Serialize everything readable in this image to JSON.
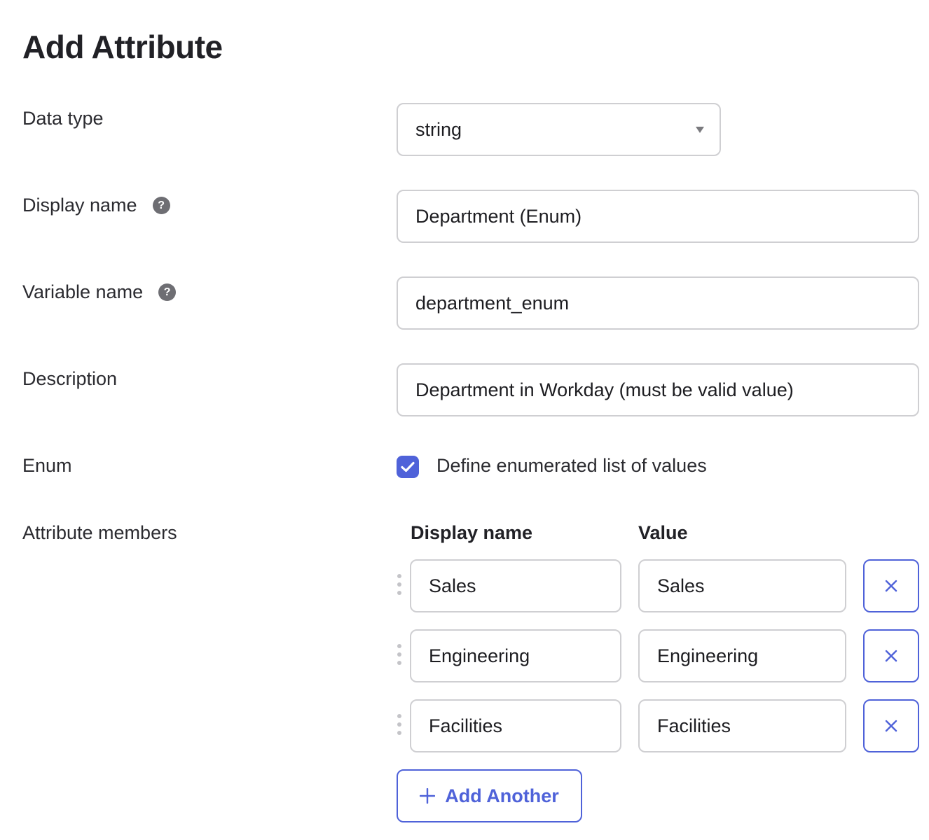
{
  "page": {
    "title": "Add Attribute"
  },
  "form": {
    "data_type": {
      "label": "Data type",
      "value": "string"
    },
    "display_name": {
      "label": "Display name",
      "value": "Department (Enum)",
      "help_icon": "question-circle-icon"
    },
    "variable_name": {
      "label": "Variable name",
      "value": "department_enum",
      "help_icon": "question-circle-icon"
    },
    "description": {
      "label": "Description",
      "value": "Department in Workday (must be valid value)"
    },
    "enum": {
      "label": "Enum",
      "checkbox_label": "Define enumerated list of values",
      "checked": true
    },
    "attribute_members": {
      "label": "Attribute members",
      "columns": {
        "display_name": "Display name",
        "value": "Value"
      },
      "rows": [
        {
          "display_name": "Sales",
          "value": "Sales"
        },
        {
          "display_name": "Engineering",
          "value": "Engineering"
        },
        {
          "display_name": "Facilities",
          "value": "Facilities"
        }
      ],
      "add_button_label": "Add Another"
    }
  },
  "colors": {
    "accent": "#4f62d9",
    "border": "#cfcfd2",
    "help_icon": "#6e6e73"
  }
}
